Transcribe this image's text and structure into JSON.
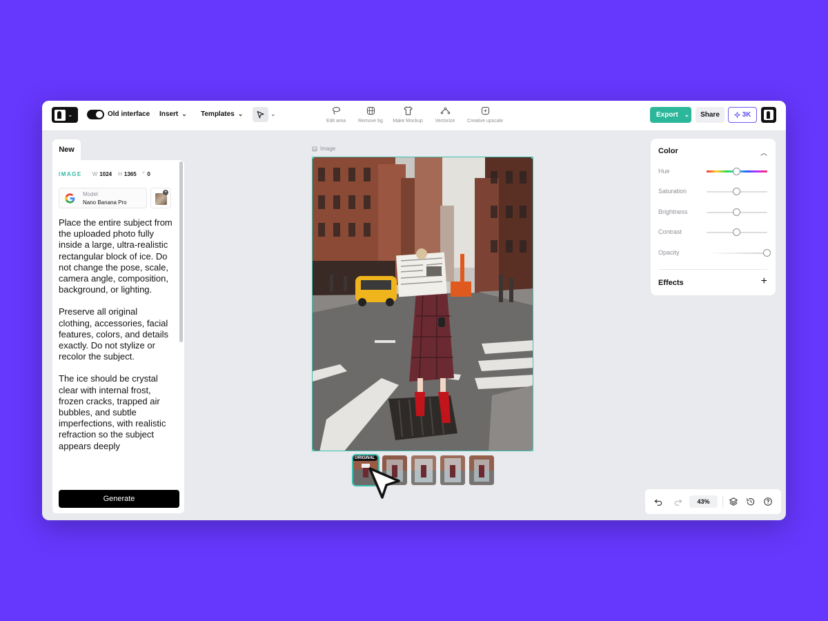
{
  "toolbar": {
    "logo_icon": "brand-logo-icon",
    "toggle_label": "Old interface",
    "insert_label": "Insert",
    "templates_label": "Templates",
    "tools": [
      {
        "label": "Edit area",
        "icon": "lasso-icon"
      },
      {
        "label": "Remove bg",
        "icon": "remove-bg-icon"
      },
      {
        "label": "Make Mockup",
        "icon": "tshirt-icon"
      },
      {
        "label": "Vectorize",
        "icon": "vector-nodes-icon"
      },
      {
        "label": "Creative upscale",
        "icon": "sparkle-upscale-icon"
      }
    ],
    "export_label": "Export",
    "share_label": "Share",
    "credits_label": "3K"
  },
  "left_panel": {
    "tab_label": "New",
    "type_tag": "IMAGE",
    "width_label": "W",
    "width_value": "1024",
    "height_label": "H",
    "height_value": "1365",
    "corner_value": "0",
    "model_label": "Model",
    "model_value": "Nano Banana Pro",
    "prompt_paragraphs": [
      "Place the entire subject from the uploaded photo fully inside a large, ultra-realistic rectangular block of ice. Do not change the pose, scale, camera angle, composition, background, or lighting.",
      "Preserve all original clothing, accessories, facial features, colors, and details exactly. Do not stylize or recolor the subject.",
      "The ice should be crystal clear with internal frost, frozen cracks, trapped air bubbles, and subtle imperfections, with realistic refraction so the subject appears deeply"
    ],
    "generate_label": "Generate"
  },
  "canvas": {
    "layer_label": "Image",
    "thumb_badge": "ORIGINAL"
  },
  "right_panel": {
    "title": "Color",
    "sliders": [
      {
        "label": "Hue",
        "value": 0.5
      },
      {
        "label": "Saturation",
        "value": 0.5
      },
      {
        "label": "Brightness",
        "value": 0.5
      },
      {
        "label": "Contrast",
        "value": 0.5
      },
      {
        "label": "Opacity",
        "value": 1.0
      }
    ],
    "effects_label": "Effects"
  },
  "bottom_bar": {
    "zoom": "43%"
  },
  "colors": {
    "background": "#6637fd",
    "accent": "#2cb79a",
    "selection": "#3bbfb0",
    "credits": "#5b4df1"
  }
}
